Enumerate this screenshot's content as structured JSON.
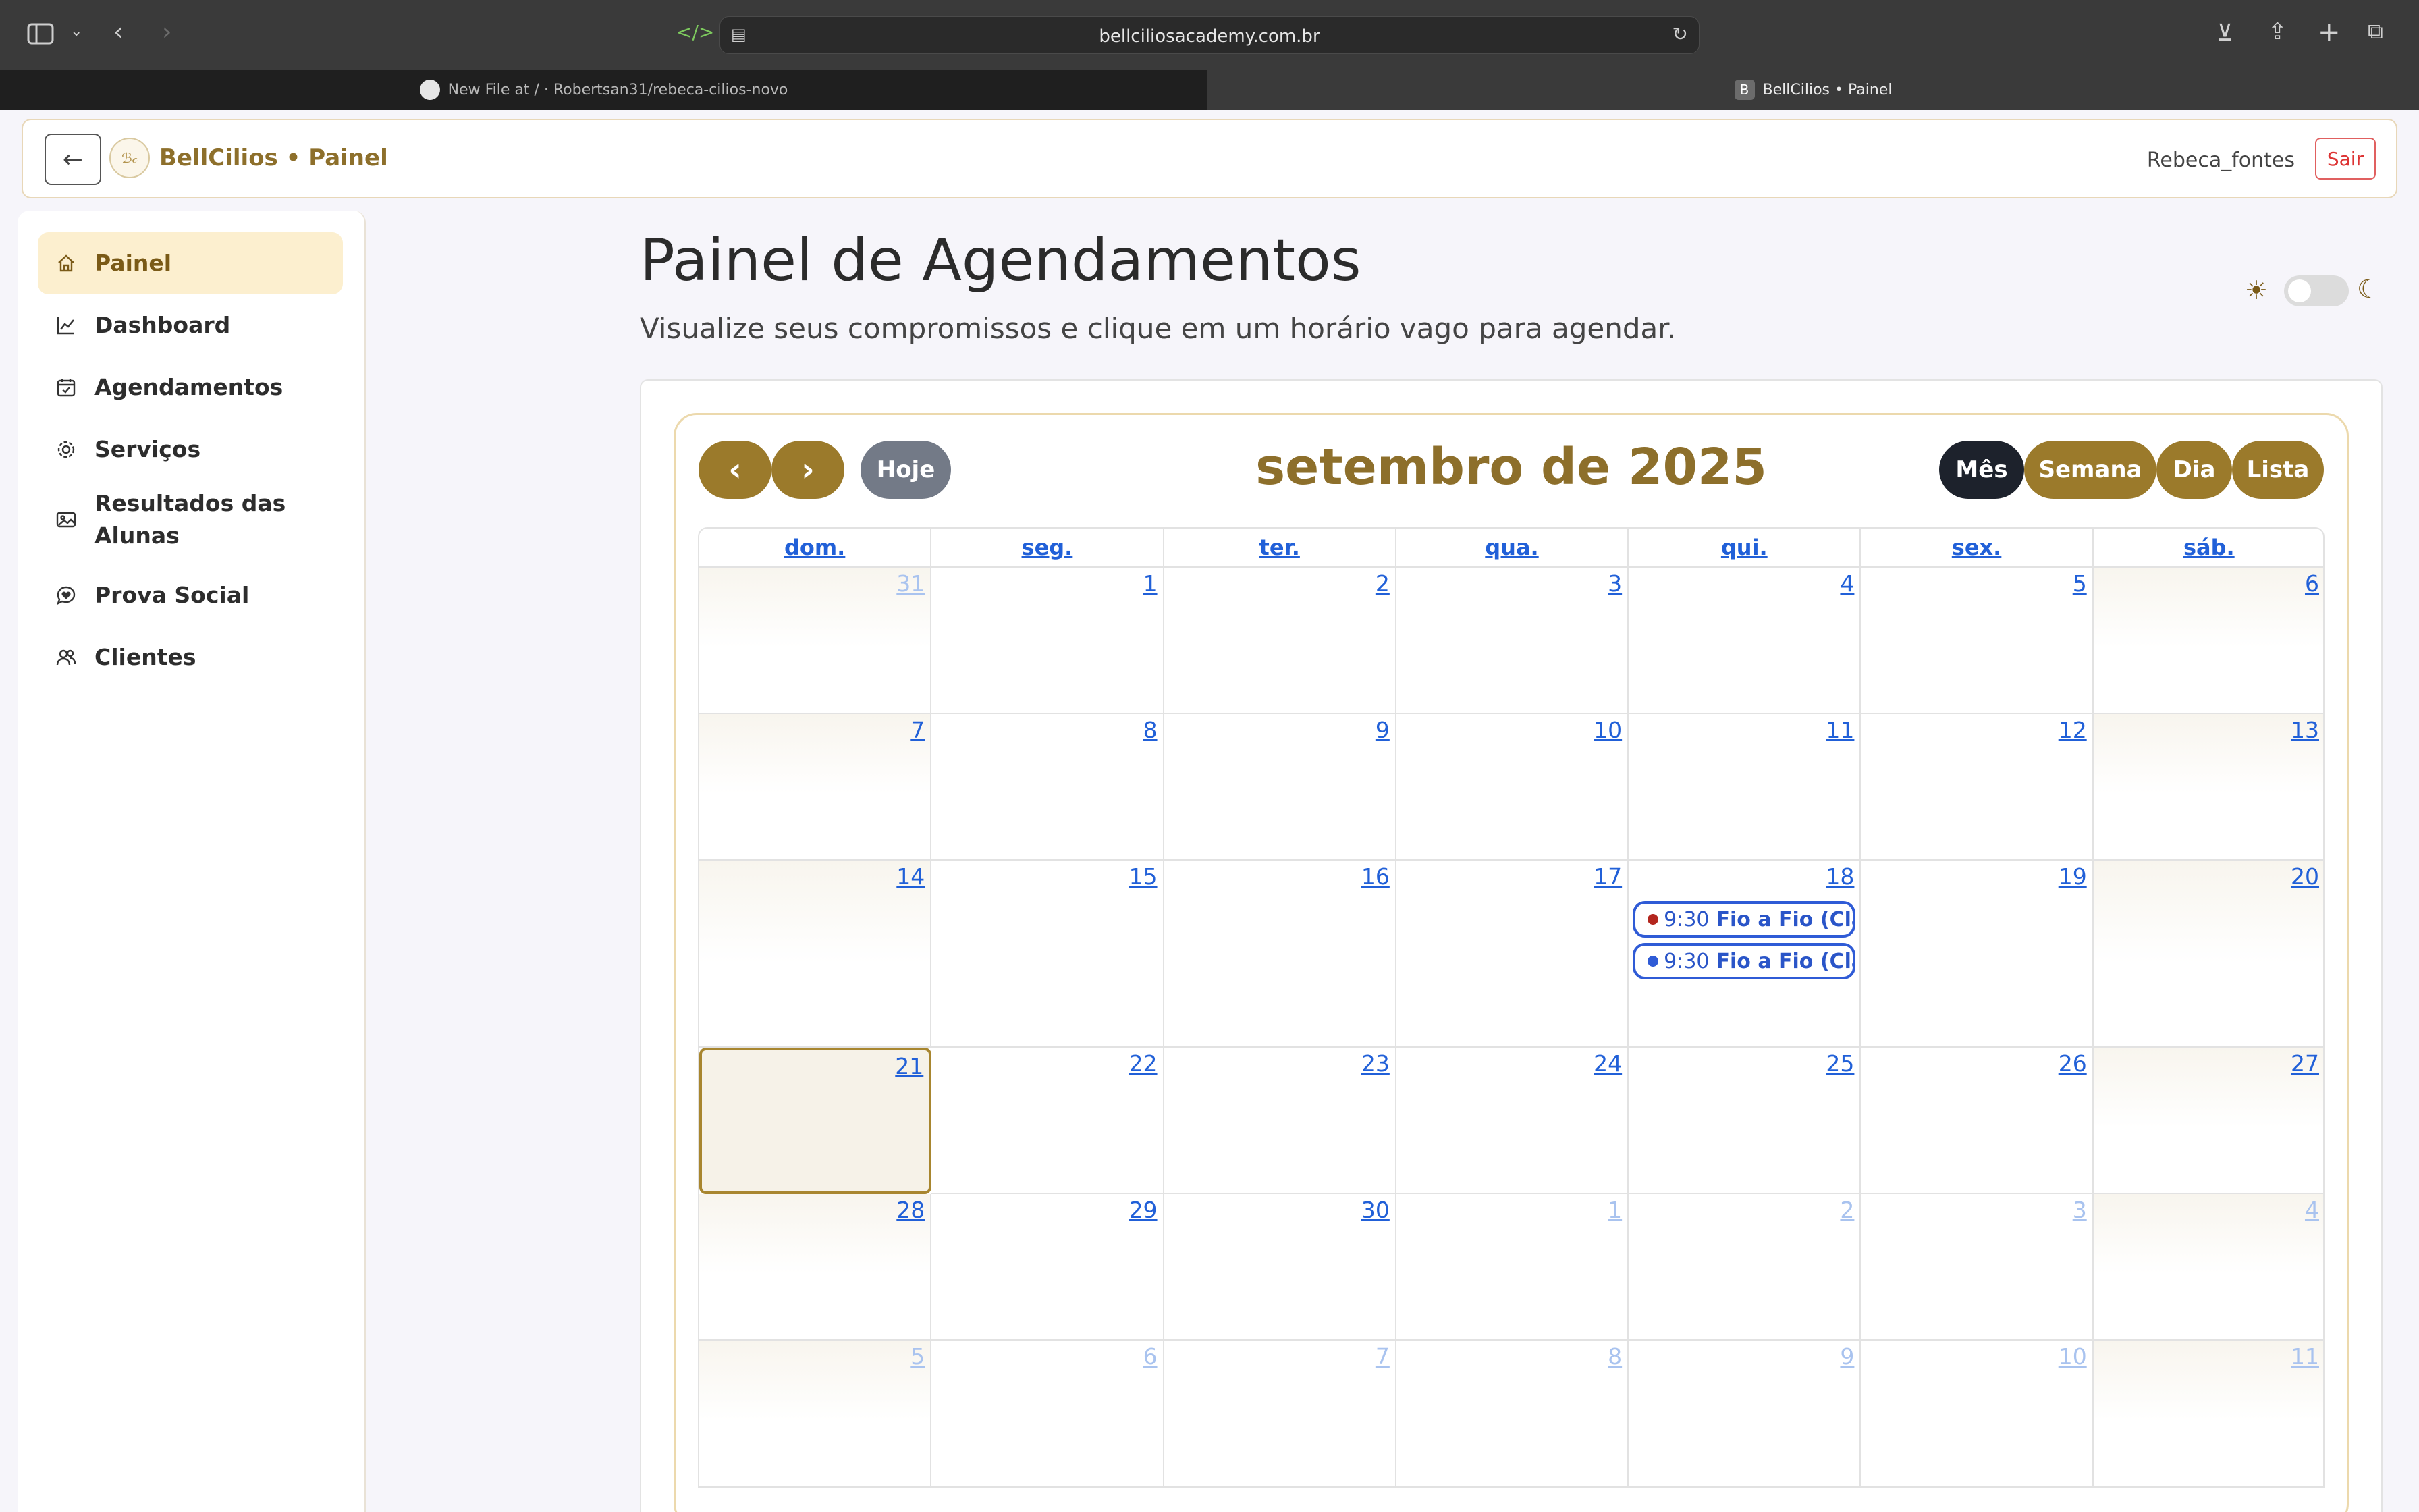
{
  "browser": {
    "url": "bellciliosacademy.com.br",
    "tabs": [
      {
        "label": "New File at / · Robertsan31/rebeca-cilios-novo"
      },
      {
        "label": "BellCilios • Painel",
        "favicon": "B"
      }
    ]
  },
  "header": {
    "brand": "BellCilios • Painel",
    "logo_text": "ℬ𝒸",
    "username": "Rebeca_fontes",
    "logout_label": "Sair",
    "back_icon": "←"
  },
  "sidebar": {
    "items": [
      {
        "label": "Painel",
        "icon": "home-icon",
        "active": true
      },
      {
        "label": "Dashboard",
        "icon": "chart-line-icon"
      },
      {
        "label": "Agendamentos",
        "icon": "calendar-check-icon"
      },
      {
        "label": "Serviços",
        "icon": "gear-icon"
      },
      {
        "label": "Resultados das Alunas",
        "icon": "image-icon"
      },
      {
        "label": "Prova Social",
        "icon": "chat-heart-icon"
      },
      {
        "label": "Clientes",
        "icon": "users-icon"
      }
    ]
  },
  "page": {
    "title": "Painel de Agendamentos",
    "subtitle": "Visualize seus compromissos e clique em um horário vago para agendar.",
    "theme_toggle": {
      "sun": "☀",
      "moon": "☾",
      "dark_mode": false
    }
  },
  "calendar": {
    "title": "setembro de 2025",
    "prev_label": "‹",
    "next_label": "›",
    "today_label": "Hoje",
    "views": [
      {
        "label": "Mês",
        "active": true
      },
      {
        "label": "Semana"
      },
      {
        "label": "Dia"
      },
      {
        "label": "Lista"
      }
    ],
    "weekdays": [
      "dom.",
      "seg.",
      "ter.",
      "qua.",
      "qui.",
      "sex.",
      "sáb."
    ],
    "weeks": [
      [
        {
          "d": "31",
          "o": true
        },
        {
          "d": "1"
        },
        {
          "d": "2"
        },
        {
          "d": "3"
        },
        {
          "d": "4"
        },
        {
          "d": "5"
        },
        {
          "d": "6"
        }
      ],
      [
        {
          "d": "7"
        },
        {
          "d": "8"
        },
        {
          "d": "9"
        },
        {
          "d": "10"
        },
        {
          "d": "11"
        },
        {
          "d": "12"
        },
        {
          "d": "13"
        }
      ],
      [
        {
          "d": "14"
        },
        {
          "d": "15"
        },
        {
          "d": "16"
        },
        {
          "d": "17"
        },
        {
          "d": "18",
          "events": [
            {
              "time": "9:30",
              "title": "Fio a Fio (Clássico)",
              "color": "#b3261e"
            },
            {
              "time": "9:30",
              "title": "Fio a Fio (Clássico)",
              "color": "#2f5bd6"
            }
          ]
        },
        {
          "d": "19"
        },
        {
          "d": "20"
        }
      ],
      [
        {
          "d": "21",
          "today": true
        },
        {
          "d": "22"
        },
        {
          "d": "23"
        },
        {
          "d": "24"
        },
        {
          "d": "25"
        },
        {
          "d": "26"
        },
        {
          "d": "27"
        }
      ],
      [
        {
          "d": "28"
        },
        {
          "d": "29"
        },
        {
          "d": "30"
        },
        {
          "d": "1",
          "o": true
        },
        {
          "d": "2",
          "o": true
        },
        {
          "d": "3",
          "o": true
        },
        {
          "d": "4",
          "o": true
        }
      ],
      [
        {
          "d": "5",
          "o": true
        },
        {
          "d": "6",
          "o": true
        },
        {
          "d": "7",
          "o": true
        },
        {
          "d": "8",
          "o": true
        },
        {
          "d": "9",
          "o": true
        },
        {
          "d": "10",
          "o": true
        },
        {
          "d": "11",
          "o": true
        }
      ]
    ]
  }
}
